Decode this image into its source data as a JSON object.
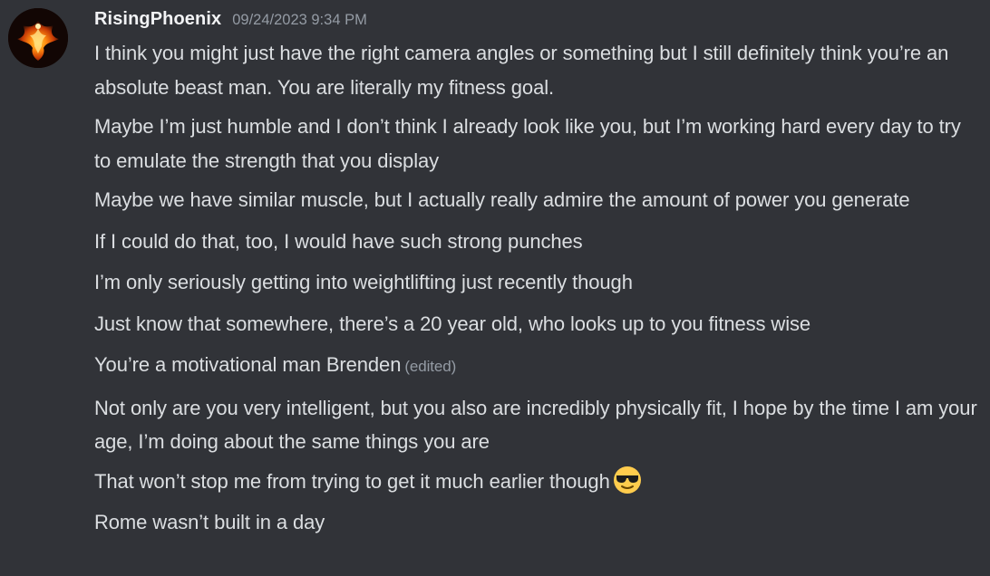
{
  "message_group": {
    "author": "RisingPhoenix",
    "timestamp": "09/24/2023 9:34 PM",
    "avatar_icon": "phoenix-avatar",
    "messages": [
      {
        "text": "I think you might just have the right camera angles or something but I still definitely think you’re an absolute beast man. You are literally my fitness goal."
      },
      {
        "text": "Maybe I’m just humble and I don’t think I already look like you, but I’m working hard every day to try to emulate the strength that you display"
      },
      {
        "text": "Maybe we have similar muscle, but I actually really admire the amount of power you generate"
      },
      {
        "text": "If I could do that, too, I would have such strong punches"
      },
      {
        "text": "I’m only seriously getting into weightlifting just recently though"
      },
      {
        "text": "Just know that somewhere, there’s a 20 year old, who looks up to you fitness wise"
      },
      {
        "text": "You’re a motivational man Brenden",
        "edited_label": "(edited)"
      },
      {
        "text": "Not only are you very intelligent, but you also are incredibly physically fit, I hope by the time I am your age, I’m doing about the same things you are"
      },
      {
        "text": "That won’t stop me from trying to get it much earlier though",
        "emoji": "sunglasses-emoji"
      },
      {
        "text": "Rome wasn’t built in a day"
      }
    ]
  },
  "colors": {
    "background": "#313338",
    "username": "#f2f3f5",
    "message_text": "#dbdee1",
    "muted_text": "#949ba4"
  }
}
